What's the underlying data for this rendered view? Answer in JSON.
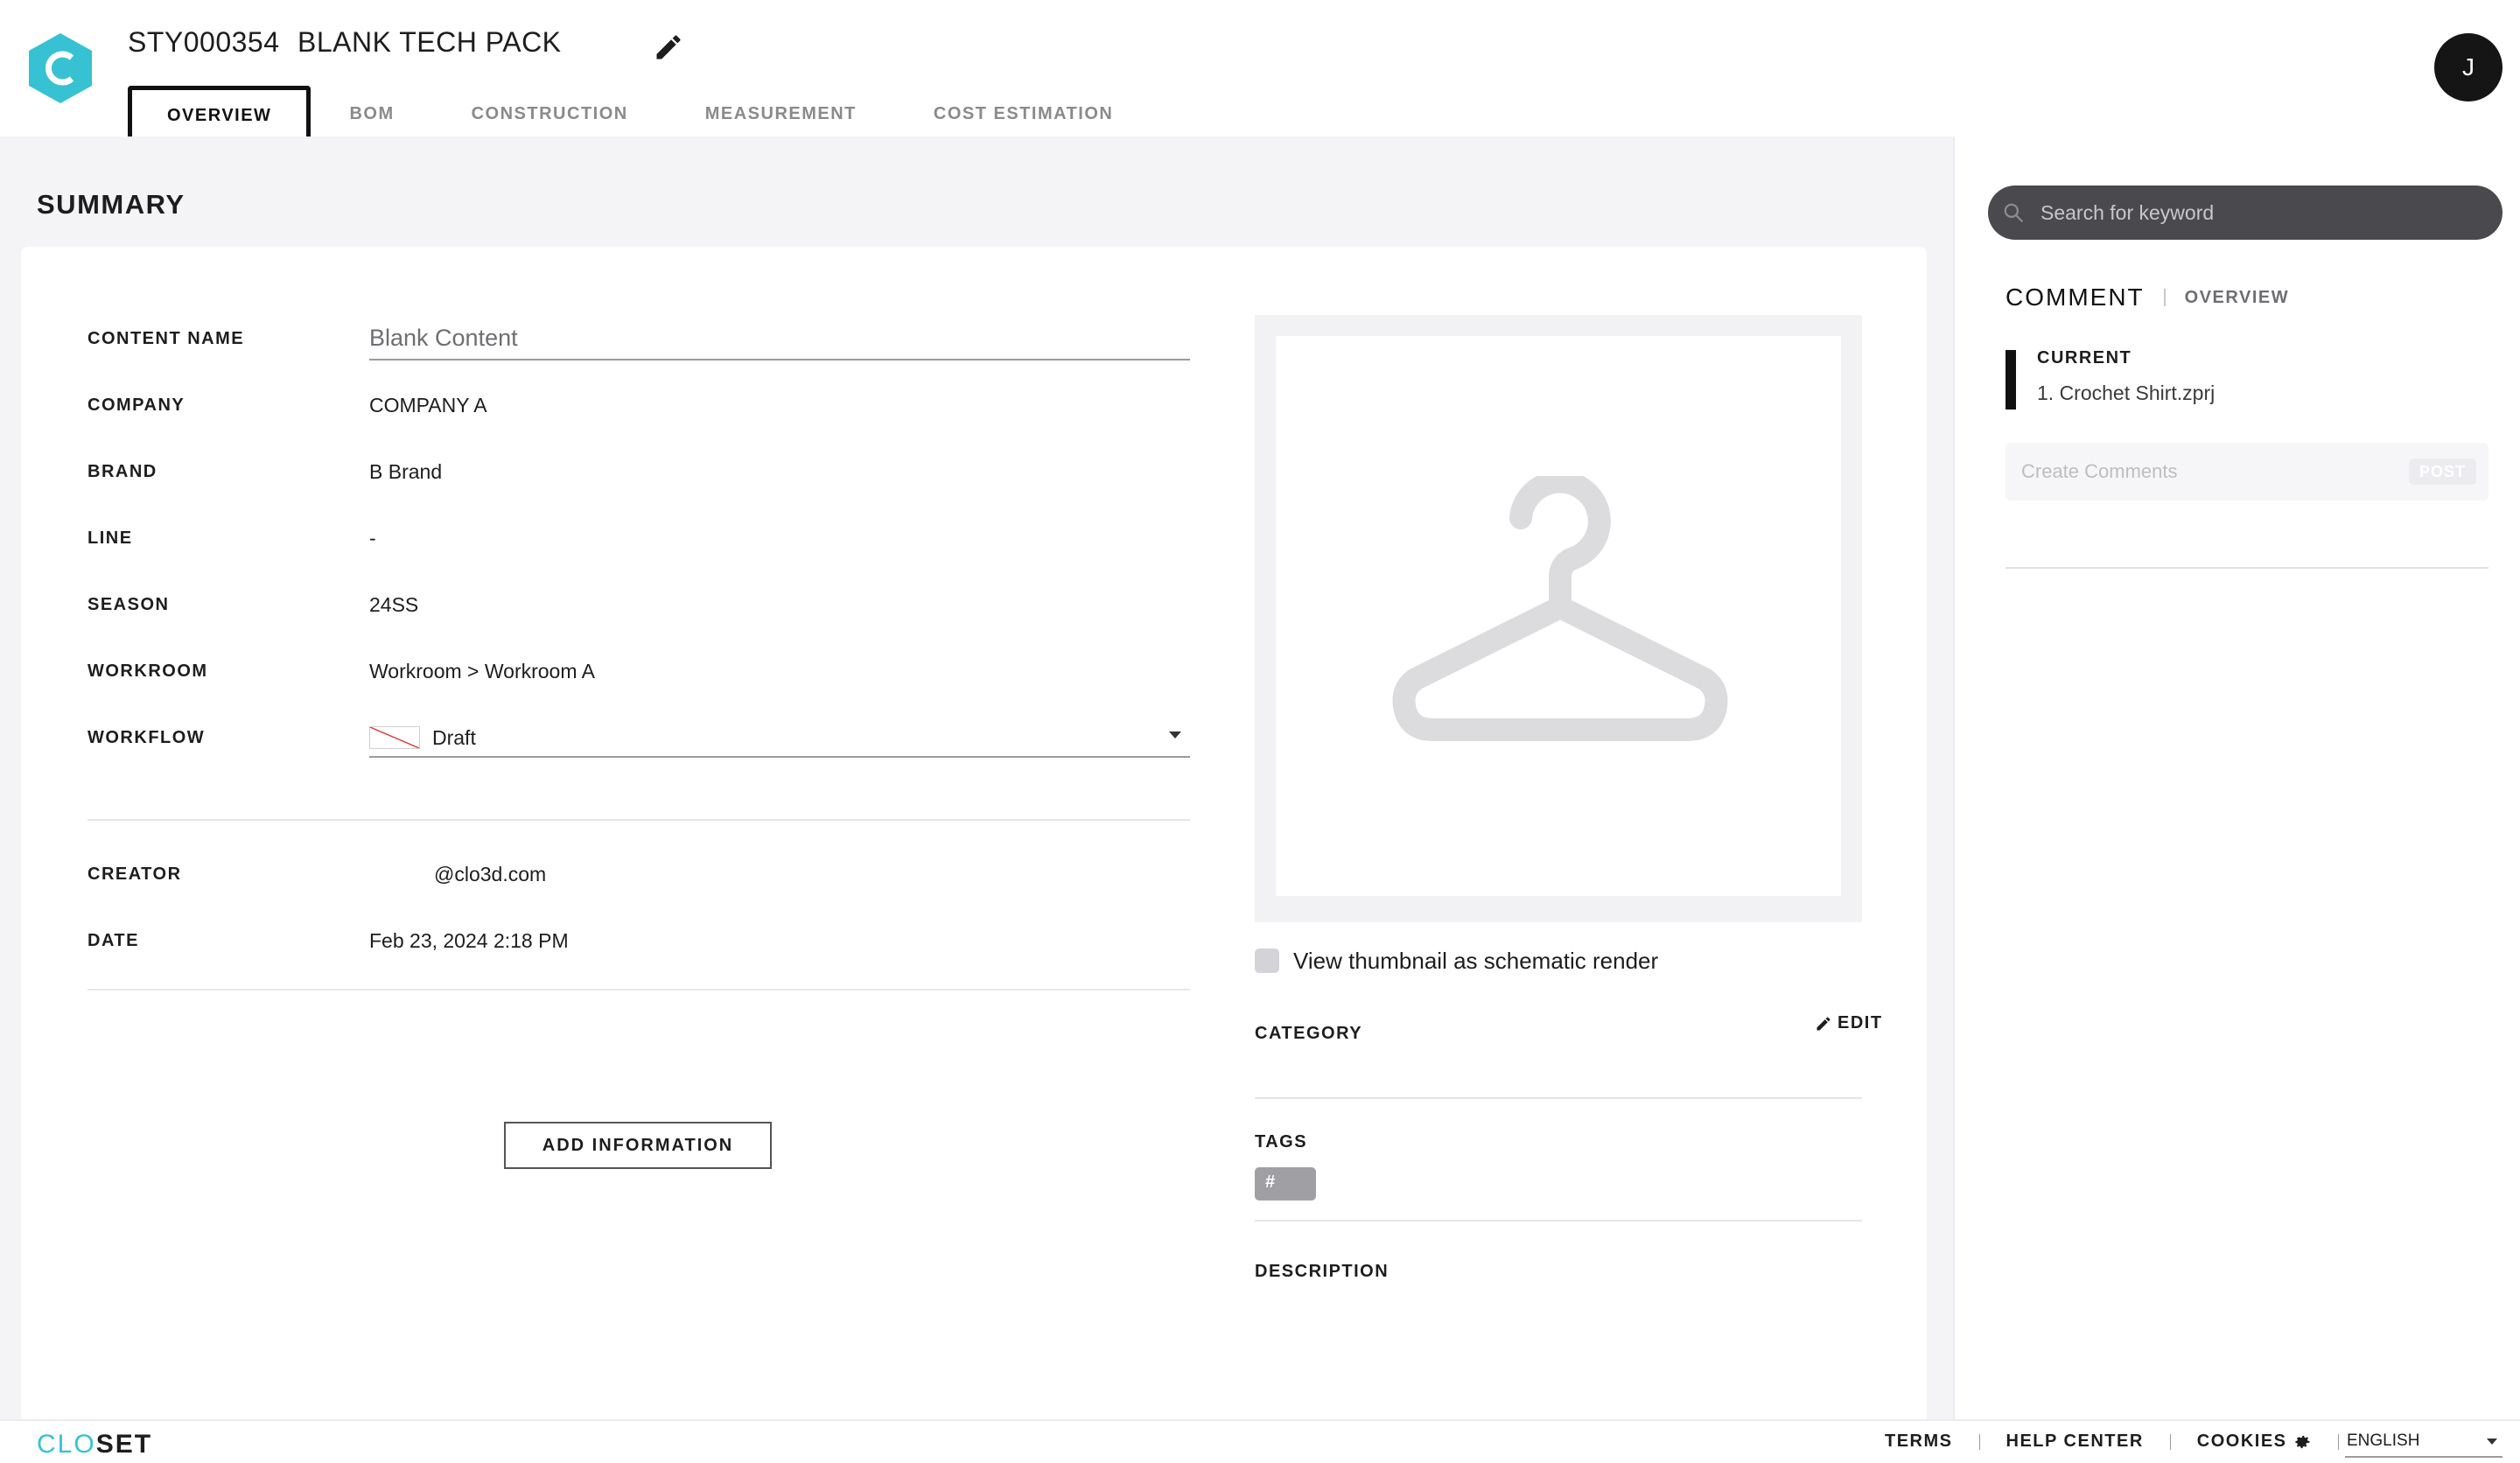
{
  "header": {
    "style_code": "STY000354",
    "style_name": "BLANK TECH PACK",
    "tabs": [
      {
        "label": "OVERVIEW",
        "active": true
      },
      {
        "label": "BOM",
        "active": false
      },
      {
        "label": "CONSTRUCTION",
        "active": false
      },
      {
        "label": "MEASUREMENT",
        "active": false
      },
      {
        "label": "COST ESTIMATION",
        "active": false
      }
    ],
    "avatar_initial": "J"
  },
  "summary": {
    "title": "SUMMARY",
    "fields": {
      "content_name": {
        "label": "CONTENT NAME",
        "placeholder": "Blank Content",
        "value": ""
      },
      "company": {
        "label": "COMPANY",
        "value": "COMPANY A"
      },
      "brand": {
        "label": "BRAND",
        "value": "B Brand"
      },
      "line": {
        "label": "LINE",
        "value": "-"
      },
      "season": {
        "label": "SEASON",
        "value": "24SS"
      },
      "workroom": {
        "label": "WORKROOM",
        "value": "Workroom > Workroom A"
      },
      "workflow": {
        "label": "WORKFLOW",
        "value": "Draft"
      },
      "creator": {
        "label": "CREATOR",
        "value": "@clo3d.com"
      },
      "date": {
        "label": "DATE",
        "value": "Feb 23, 2024 2:18 PM"
      }
    },
    "add_information_label": "ADD INFORMATION",
    "thumbnail": {
      "icon": "hanger-icon",
      "schematic_label": "View thumbnail as schematic render",
      "schematic_checked": false
    },
    "category": {
      "label": "CATEGORY",
      "edit_label": "EDIT"
    },
    "tags": {
      "label": "TAGS",
      "chip": "#"
    },
    "description": {
      "label": "DESCRIPTION"
    }
  },
  "panel": {
    "search_placeholder": "Search for keyword",
    "tab_comment": "COMMENT",
    "tab_overview": "OVERVIEW",
    "current_label": "CURRENT",
    "current_file": "1. Crochet Shirt.zprj",
    "comment_placeholder": "Create Comments",
    "post_label": "POST"
  },
  "footer": {
    "logo_clo": "CLO",
    "logo_set": "SET",
    "terms": "TERMS",
    "help_center": "HELP CENTER",
    "cookies": "COOKIES",
    "language": "ENGLISH"
  },
  "colors": {
    "brand_accent": "#36c2d3",
    "dark": "#1d1d1f",
    "main_bg": "#f4f4f6",
    "search_bg": "#4a4a4e"
  }
}
